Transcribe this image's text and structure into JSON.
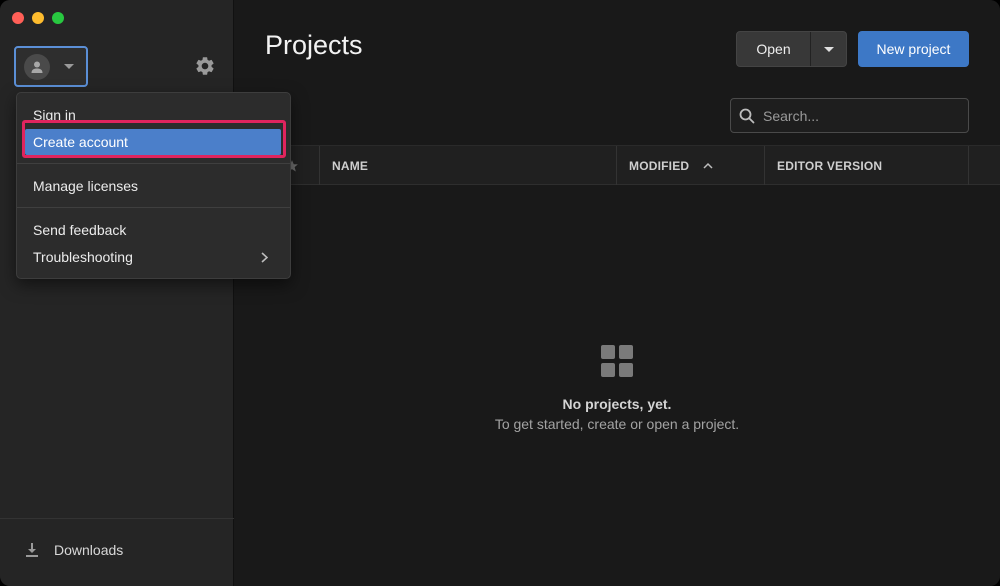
{
  "window": {
    "traffic_lights": [
      "close",
      "minimize",
      "maximize"
    ],
    "colors": {
      "close": "#ff5f57",
      "minimize": "#febc2e",
      "maximize": "#28c840"
    }
  },
  "sidebar": {
    "account_icon": "person-icon",
    "settings_icon": "gear-icon",
    "downloads": {
      "icon": "download-icon",
      "label": "Downloads"
    }
  },
  "account_menu": {
    "items": [
      {
        "label": "Sign in"
      },
      {
        "label": "Create account",
        "selected": true
      },
      {
        "label": "Manage licenses"
      },
      {
        "label": "Send feedback"
      },
      {
        "label": "Troubleshooting",
        "submenu": true
      }
    ],
    "highlight_color": "#e0245e",
    "selected_color": "#4b7fca"
  },
  "main": {
    "title": "Projects",
    "open_button": "Open",
    "new_project_button": "New project",
    "accent_color": "#3d78c6",
    "search": {
      "placeholder": "Search...",
      "value": ""
    },
    "table": {
      "columns": [
        "NAME",
        "MODIFIED",
        "EDITOR VERSION"
      ],
      "sorted_by": "MODIFIED",
      "sort_direction": "ascending"
    },
    "empty_state": {
      "icon": "grid-icon",
      "title": "No projects, yet.",
      "subtitle": "To get started, create or open a project."
    }
  }
}
